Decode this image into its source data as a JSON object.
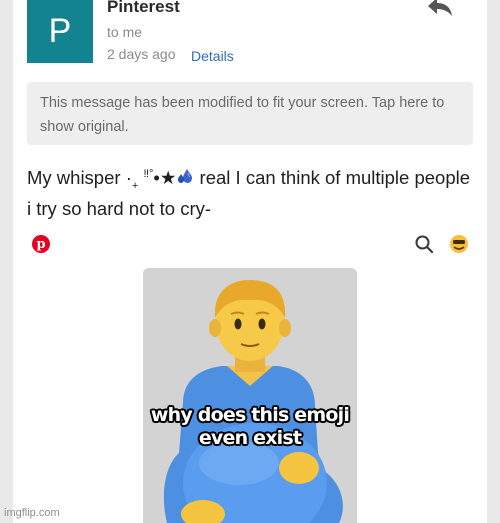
{
  "email": {
    "avatar_letter": "P",
    "sender": "Pinterest",
    "recipient": "to me",
    "date": "2 days ago",
    "details_link": "Details",
    "notice": "This message has been modified to fit your screen. Tap here to show original.",
    "body_part1": "My whisper ·",
    "body_sub": "+",
    "body_sup": "‼°",
    "body_part2": "•★",
    "body_part3": " real I can think of multiple people i try so hard not to cry-"
  },
  "pin": {
    "caption": "why does this emoji even exist"
  },
  "watermark": "imgflip.com",
  "colors": {
    "avatar_bg": "#12838f",
    "link": "#2f6db5",
    "pinterest_red": "#e60023",
    "notice_bg": "#eeeeee"
  },
  "icons": [
    "reply-icon",
    "pinterest-logo-icon",
    "search-icon",
    "emoji-avatar-icon",
    "sweat-droplets-icon"
  ]
}
